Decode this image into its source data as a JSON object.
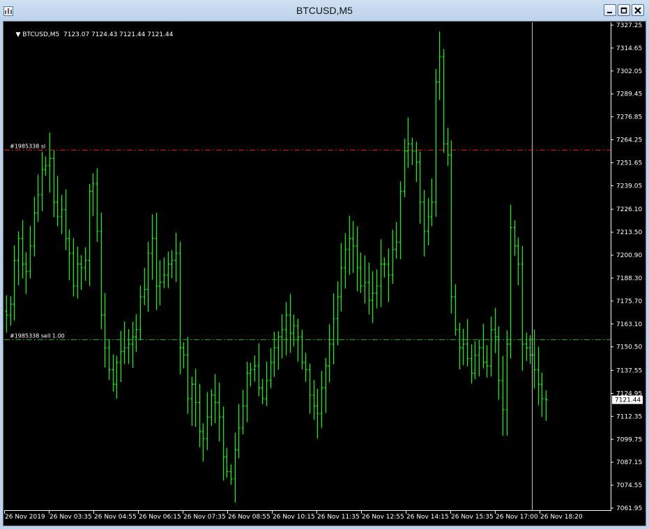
{
  "window": {
    "title": "BTCUSD,M5",
    "icon": "chart-window-icon",
    "buttons": [
      {
        "name": "minimize-button",
        "icon": "minimize-icon"
      },
      {
        "name": "maximize-button",
        "icon": "maximize-icon"
      },
      {
        "name": "close-button",
        "icon": "close-icon"
      }
    ]
  },
  "chart_header": {
    "dropdown_icon": "triangle-down-icon",
    "symbol": "BTCUSD,M5",
    "ohlc": "7123.07 7124.43 7121.44 7121.44"
  },
  "colors": {
    "background": "#000000",
    "candle": "#00ff00",
    "stop_loss_line": "#ff0000",
    "order_line": "#00b400",
    "axis_text": "#ffffff",
    "crosshair": "#c8c8c8"
  },
  "chart_data": {
    "type": "candlestick-bar",
    "title": "BTCUSD,M5",
    "y_ticks": [
      "7327.25",
      "7314.65",
      "7302.05",
      "7289.45",
      "7276.85",
      "7264.25",
      "7251.65",
      "7239.05",
      "7226.10",
      "7213.50",
      "7200.90",
      "7188.30",
      "7175.70",
      "7163.10",
      "7150.50",
      "7137.55",
      "7124.95",
      "7112.35",
      "7099.75",
      "7087.15",
      "7074.55",
      "7061.95"
    ],
    "ylim": [
      7061.95,
      7327.25
    ],
    "x_ticks": [
      "26 Nov 2019",
      "26 Nov 03:35",
      "26 Nov 04:55",
      "26 Nov 06:15",
      "26 Nov 07:35",
      "26 Nov 08:55",
      "26 Nov 10:15",
      "26 Nov 11:35",
      "26 Nov 12:55",
      "26 Nov 14:15",
      "26 Nov 15:35",
      "26 Nov 17:00",
      "26 Nov 18:20"
    ],
    "current_price": "7121.44",
    "levels": [
      {
        "label": "#1985338 sl",
        "price": 7258.9,
        "color": "#ff0000"
      },
      {
        "label": "#1985338 sell 1.00",
        "price": 7154.6,
        "color": "#00b400"
      }
    ],
    "close": [
      7168,
      7174,
      7198,
      7210,
      7196,
      7192,
      7206,
      7224,
      7234,
      7248,
      7250,
      7254,
      7230,
      7222,
      7226,
      7210,
      7202,
      7184,
      7196,
      7194,
      7198,
      7236,
      7240,
      7214,
      7168,
      7150,
      7138,
      7130,
      7142,
      7148,
      7150,
      7152,
      7156,
      7160,
      7178,
      7182,
      7202,
      7210,
      7184,
      7186,
      7190,
      7196,
      7198,
      7202,
      7150,
      7146,
      7122,
      7130,
      7120,
      7104,
      7100,
      7112,
      7124,
      7120,
      7112,
      7090,
      7082,
      7078,
      7094,
      7106,
      7118,
      7136,
      7138,
      7140,
      7128,
      7122,
      7132,
      7142,
      7150,
      7156,
      7160,
      7168,
      7158,
      7162,
      7156,
      7142,
      7138,
      7124,
      7118,
      7114,
      7128,
      7140,
      7152,
      7166,
      7178,
      7194,
      7204,
      7210,
      7206,
      7194,
      7184,
      7186,
      7176,
      7180,
      7184,
      7196,
      7196,
      7190,
      7204,
      7208,
      7236,
      7258,
      7262,
      7258,
      7252,
      7230,
      7214,
      7222,
      7230,
      7296,
      7310,
      7262,
      7256,
      7178,
      7160,
      7150,
      7152,
      7144,
      7136,
      7146,
      7150,
      7142,
      7140,
      7160,
      7156,
      7132,
      7116,
      7152,
      7216,
      7206,
      7196,
      7152,
      7150,
      7146,
      7138,
      7130,
      7122,
      7121.44
    ]
  }
}
